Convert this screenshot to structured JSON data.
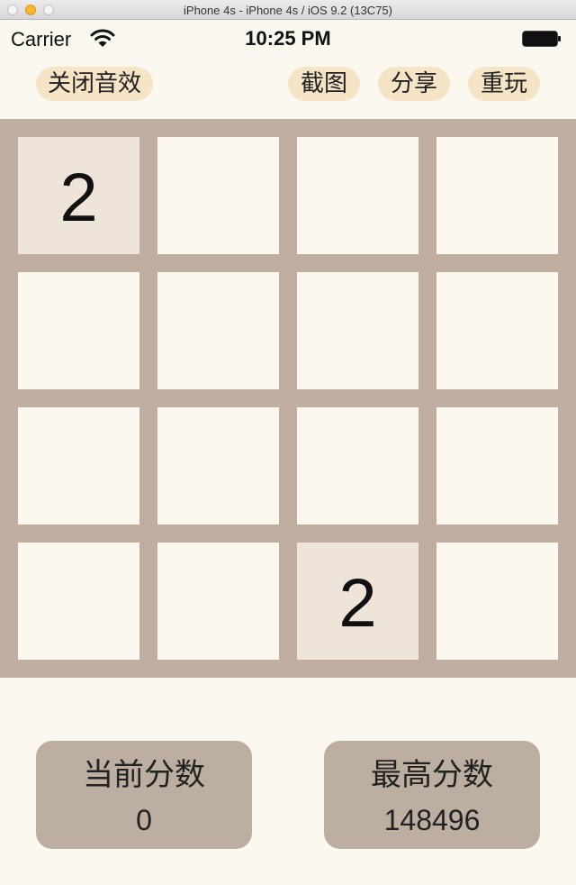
{
  "window": {
    "title": "iPhone 4s - iPhone 4s / iOS 9.2 (13C75)"
  },
  "status_bar": {
    "carrier": "Carrier",
    "time": "10:25 PM"
  },
  "toolbar": {
    "sound_toggle_label": "关闭音效",
    "screenshot_label": "截图",
    "share_label": "分享",
    "replay_label": "重玩"
  },
  "board": {
    "rows": [
      [
        "2",
        "",
        "",
        ""
      ],
      [
        "",
        "",
        "",
        ""
      ],
      [
        "",
        "",
        "",
        ""
      ],
      [
        "",
        "",
        "2",
        ""
      ]
    ]
  },
  "scores": {
    "current_label": "当前分数",
    "current_value": "0",
    "best_label": "最高分数",
    "best_value": "148496"
  },
  "colors": {
    "background": "#fbf8f0",
    "board": "#bfada0",
    "empty_tile": "#fcf8ef",
    "tile_2": "#eee4da",
    "button": "#f5e4c6",
    "score_box": "#bcaea1"
  }
}
